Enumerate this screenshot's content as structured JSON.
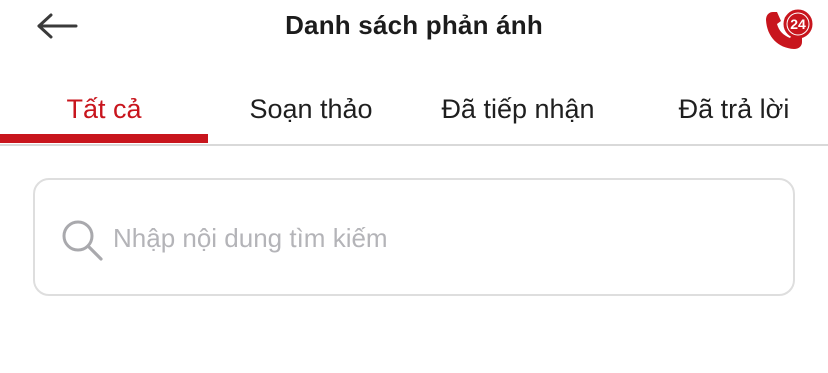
{
  "header": {
    "back_icon": "arrow-left-icon",
    "title": "Danh sách phản ánh",
    "hotline_icon": "phone-24-icon",
    "hotline_badge": "24"
  },
  "tabs": [
    {
      "label": "Tất cả",
      "active": true
    },
    {
      "label": "Soạn thảo",
      "active": false
    },
    {
      "label": "Đã tiếp nhận",
      "active": false
    },
    {
      "label": "Đã trả lời",
      "active": false
    }
  ],
  "search": {
    "icon": "search-icon",
    "value": "",
    "placeholder": "Nhập nội dung tìm kiếm"
  },
  "colors": {
    "accent": "#c8151d",
    "text": "#1f1f1f",
    "placeholder": "#b4b4b8",
    "border": "#dedede"
  }
}
